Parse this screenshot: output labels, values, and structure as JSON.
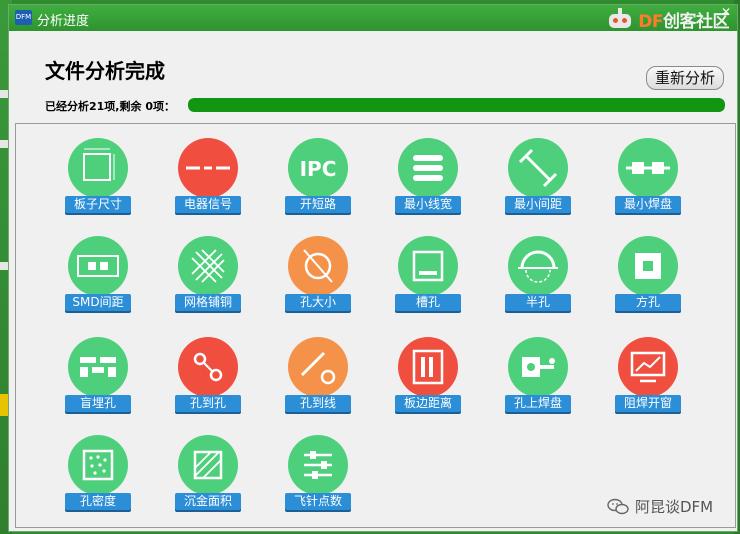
{
  "window": {
    "title": "分析进度",
    "app_icon": "DFM"
  },
  "brand": {
    "prefix": "DF",
    "name": "创客社区"
  },
  "heading": "文件分析完成",
  "restart_label": "重新分析",
  "status_text": "已经分析21项,剩余 0项：",
  "progress_fraction": 1.0,
  "items": [
    {
      "label": "板子尺寸",
      "color": "green",
      "icon": "board-size-icon"
    },
    {
      "label": "电器信号",
      "color": "red",
      "icon": "electrical-signal-icon"
    },
    {
      "label": "开短路",
      "color": "green",
      "icon": "ipc-icon",
      "icon_text": "IPC"
    },
    {
      "label": "最小线宽",
      "color": "green",
      "icon": "min-line-width-icon"
    },
    {
      "label": "最小间距",
      "color": "green",
      "icon": "min-spacing-icon"
    },
    {
      "label": "最小焊盘",
      "color": "green",
      "icon": "min-pad-icon"
    },
    {
      "label": "SMD间距",
      "color": "green",
      "icon": "smd-spacing-icon"
    },
    {
      "label": "网格铺铜",
      "color": "green",
      "icon": "grid-copper-icon"
    },
    {
      "label": "孔大小",
      "color": "orange",
      "icon": "hole-size-icon"
    },
    {
      "label": "槽孔",
      "color": "green",
      "icon": "slot-hole-icon"
    },
    {
      "label": "半孔",
      "color": "green",
      "icon": "half-hole-icon"
    },
    {
      "label": "方孔",
      "color": "green",
      "icon": "square-hole-icon"
    },
    {
      "label": "盲埋孔",
      "color": "green",
      "icon": "blind-buried-via-icon"
    },
    {
      "label": "孔到孔",
      "color": "red",
      "icon": "hole-to-hole-icon"
    },
    {
      "label": "孔到线",
      "color": "orange",
      "icon": "hole-to-line-icon"
    },
    {
      "label": "板边距离",
      "color": "red",
      "icon": "board-edge-distance-icon"
    },
    {
      "label": "孔上焊盘",
      "color": "green",
      "icon": "pad-on-hole-icon"
    },
    {
      "label": "阻焊开窗",
      "color": "red",
      "icon": "solder-mask-window-icon"
    },
    {
      "label": "孔密度",
      "color": "green",
      "icon": "hole-density-icon"
    },
    {
      "label": "沉金面积",
      "color": "green",
      "icon": "gold-area-icon"
    },
    {
      "label": "飞针点数",
      "color": "green",
      "icon": "flying-probe-icon"
    }
  ],
  "watermark": "阿昆谈DFM",
  "colors": {
    "green": "#4ecf7c",
    "red": "#f04f40",
    "orange": "#f5924a",
    "label_bg": "#2b8ed6",
    "progress": "#129612"
  }
}
